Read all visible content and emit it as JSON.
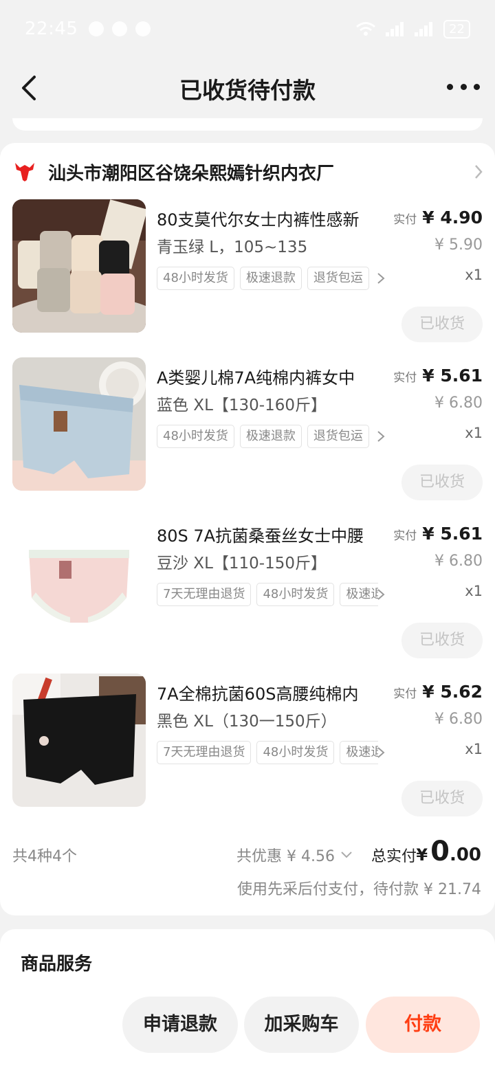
{
  "status_bar": {
    "time": "22:45",
    "battery": "22"
  },
  "nav": {
    "title": "已收货待付款"
  },
  "shop": {
    "name": "汕头市潮阳区谷饶朵熙嫣针织内衣厂"
  },
  "items": [
    {
      "title": "80支莫代尔女士内裤性感新",
      "spec": "青玉绿 L，105~135",
      "tags": [
        "48小时发货",
        "极速退款",
        "退货包运"
      ],
      "price_label": "实付",
      "price": "¥ 4.90",
      "original_price": "¥ 5.90",
      "qty": "x1",
      "status": "已收货"
    },
    {
      "title": "A类婴儿棉7A纯棉内裤女中",
      "spec": "蓝色 XL【130-160斤】",
      "tags": [
        "48小时发货",
        "极速退款",
        "退货包运"
      ],
      "price_label": "实付",
      "price": "¥ 5.61",
      "original_price": "¥ 6.80",
      "qty": "x1",
      "status": "已收货"
    },
    {
      "title": "80S 7A抗菌桑蚕丝女士中腰",
      "spec": "豆沙 XL【110-150斤】",
      "tags": [
        "7天无理由退货",
        "48小时发货",
        "极速退款"
      ],
      "price_label": "实付",
      "price": "¥ 5.61",
      "original_price": "¥ 6.80",
      "qty": "x1",
      "status": "已收货"
    },
    {
      "title": "7A全棉抗菌60S高腰纯棉内",
      "spec": "黑色 XL（130一150斤）",
      "tags": [
        "7天无理由退货",
        "48小时发货",
        "极速退款"
      ],
      "price_label": "实付",
      "price": "¥ 5.62",
      "original_price": "¥ 6.80",
      "qty": "x1",
      "status": "已收货"
    }
  ],
  "summary": {
    "count": "共4种4个",
    "discount": "共优惠 ¥ 4.56",
    "total_label": "总实付",
    "total_currency": "¥",
    "total_int": "0",
    "total_dec": ".00",
    "note": "使用先采后付支付，待付款 ¥ 21.74"
  },
  "service": {
    "title": "商品服务",
    "refund": "申请退款",
    "cart": "加采购车",
    "pay": "付款"
  },
  "colors": {
    "accent": "#ff3d12",
    "pay_bg": "#ffe6de",
    "shop_logo": "#e8201f"
  }
}
